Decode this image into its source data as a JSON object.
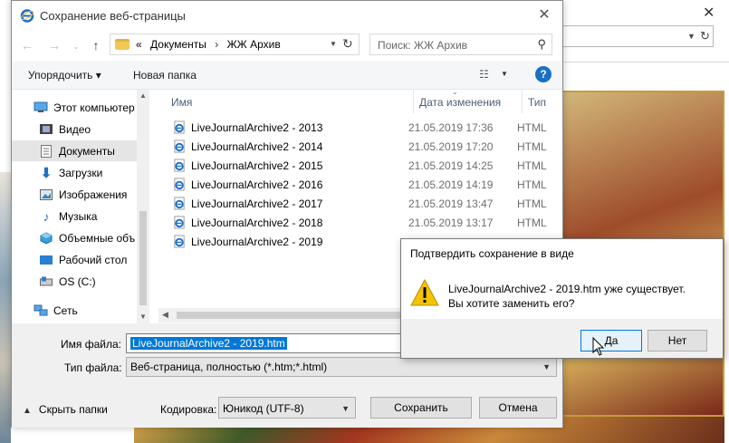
{
  "dialog": {
    "title": "Сохранение веб-страницы",
    "close_glyph": "✕"
  },
  "nav": {
    "back_glyph": "←",
    "forward_glyph": "→",
    "dd_glyph": "⌄",
    "up_glyph": "↑",
    "breadcrumb_prefix": "«",
    "breadcrumbs": [
      "Документы",
      "ЖЖ Архив"
    ],
    "breadcrumb_sep": "›",
    "search_placeholder": "Поиск: ЖЖ Архив"
  },
  "toolbar": {
    "organize_label": "Упорядочить ▾",
    "new_folder_label": "Новая папка",
    "help_label": "?"
  },
  "sidebar": {
    "items": [
      {
        "label": "Этот компьютер",
        "icon": "computer-icon"
      },
      {
        "label": "Видео",
        "icon": "video-icon"
      },
      {
        "label": "Документы",
        "icon": "documents-icon",
        "selected": true
      },
      {
        "label": "Загрузки",
        "icon": "downloads-icon"
      },
      {
        "label": "Изображения",
        "icon": "pictures-icon"
      },
      {
        "label": "Музыка",
        "icon": "music-icon"
      },
      {
        "label": "Объемные объ",
        "icon": "3d-objects-icon"
      },
      {
        "label": "Рабочий стол",
        "icon": "desktop-icon"
      },
      {
        "label": "OS (C:)",
        "icon": "drive-icon"
      },
      {
        "label": "Сеть",
        "icon": "network-icon"
      }
    ]
  },
  "files": {
    "columns": {
      "name": "Имя",
      "date": "Дата изменения",
      "type": "Тип"
    },
    "rows": [
      {
        "name": "LiveJournalArchive2 - 2013",
        "date": "21.05.2019 17:36",
        "type": "HTML"
      },
      {
        "name": "LiveJournalArchive2 - 2014",
        "date": "21.05.2019 17:20",
        "type": "HTML"
      },
      {
        "name": "LiveJournalArchive2 - 2015",
        "date": "21.05.2019 14:25",
        "type": "HTML"
      },
      {
        "name": "LiveJournalArchive2 - 2016",
        "date": "21.05.2019 14:19",
        "type": "HTML"
      },
      {
        "name": "LiveJournalArchive2 - 2017",
        "date": "21.05.2019 13:47",
        "type": "HTML"
      },
      {
        "name": "LiveJournalArchive2 - 2018",
        "date": "21.05.2019 13:17",
        "type": "HTML"
      },
      {
        "name": "LiveJournalArchive2 - 2019",
        "date": "",
        "type": ""
      }
    ]
  },
  "form": {
    "filename_label": "Имя файла:",
    "filename_value": "LiveJournalArchive2 - 2019.htm",
    "filetype_label": "Тип файла:",
    "filetype_value": "Веб-страница, полностью (*.htm;*.html)",
    "hide_folders_label": "Скрыть папки",
    "encoding_label": "Кодировка:",
    "encoding_value": "Юникод (UTF-8)",
    "save_label": "Сохранить",
    "cancel_label": "Отмена"
  },
  "confirm": {
    "title": "Подтвердить сохранение в виде",
    "message_line1": "LiveJournalArchive2 - 2019.htm уже существует.",
    "message_line2": "Вы хотите заменить его?",
    "yes_label": "Да",
    "no_label": "Нет"
  },
  "colors": {
    "accent": "#0078d7",
    "ie_blue": "#1a6fc7",
    "warning_yellow": "#f5c400"
  }
}
